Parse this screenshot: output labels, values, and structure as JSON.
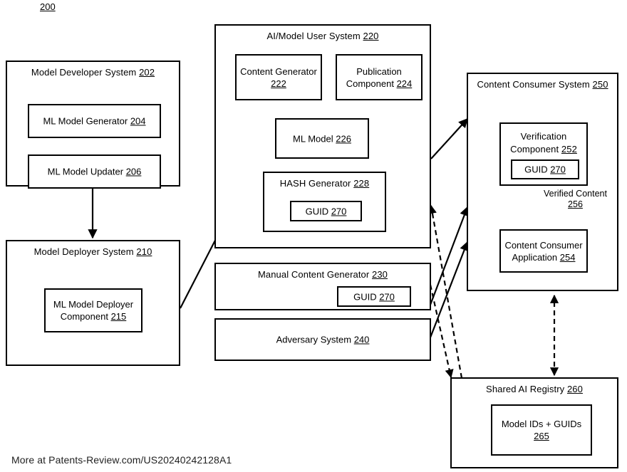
{
  "figure": {
    "number": "200",
    "footer": "More at Patents-Review.com/US20240242128A1"
  },
  "boxes": {
    "model_developer_system": {
      "title": "Model Developer System",
      "ref": "202",
      "children": {
        "ml_model_generator": {
          "title": "ML Model Generator",
          "ref": "204"
        },
        "ml_model_updater": {
          "title": "ML Model Updater ",
          "ref": "206"
        }
      }
    },
    "model_deployer_system": {
      "title": "Model Deployer System",
      "ref": "210",
      "children": {
        "ml_model_deployer_component": {
          "title": "ML Model Deployer Component",
          "ref": "215"
        }
      }
    },
    "ai_model_user_system": {
      "title": "AI/Model User System",
      "ref": "220",
      "children": {
        "content_generator": {
          "title": "Content Generator",
          "ref": "222"
        },
        "publication_component": {
          "title": "Publication Component",
          "ref": "224"
        },
        "ml_model": {
          "title": "ML Model",
          "ref": "226"
        },
        "hash_generator": {
          "title": "HASH Generator",
          "ref": "228"
        },
        "hash_guid": {
          "title": "GUID",
          "ref": "270"
        }
      }
    },
    "manual_content_generator": {
      "title": "Manual Content Generator",
      "ref": "230",
      "children": {
        "manual_guid": {
          "title": "GUID",
          "ref": "270"
        }
      }
    },
    "adversary_system": {
      "title": "Adversary System",
      "ref": "240"
    },
    "content_consumer_system": {
      "title": "Content Consumer System",
      "ref": "250",
      "children": {
        "verification_component": {
          "title": "Verification Component",
          "ref": "252"
        },
        "verification_guid": {
          "title": "GUID",
          "ref": "270"
        },
        "content_consumer_application": {
          "title": "Content Consumer Application ",
          "ref": "254"
        }
      }
    },
    "shared_ai_registry": {
      "title": "Shared AI Registry",
      "ref": "260",
      "children": {
        "model_ids_guids": {
          "title": "Model IDs + GUIDs",
          "ref": "265"
        }
      }
    }
  },
  "edge_labels": {
    "verified_content": {
      "title": "Verified Content",
      "ref": "256"
    }
  }
}
